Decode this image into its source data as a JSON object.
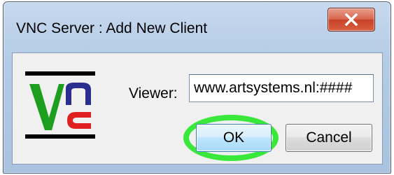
{
  "dialog": {
    "title": "VNC Server : Add New Client",
    "close_icon": "close-icon",
    "logo_icon": "vnc-logo-icon"
  },
  "viewer": {
    "label": "Viewer:",
    "value": "www.artsystems.nl:####"
  },
  "buttons": {
    "ok_label": "OK",
    "cancel_label": "Cancel"
  },
  "colors": {
    "titlebar": "#b3cbe6",
    "close_button": "#c8412a",
    "ok_highlight": "#39e83a",
    "logo_green": "#1e9e1e",
    "logo_blue": "#2a2f8f",
    "logo_red": "#e02020"
  }
}
